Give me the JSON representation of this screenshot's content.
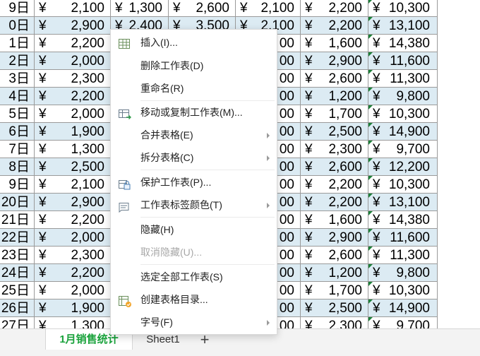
{
  "columns": {
    "currency_symbol": "¥"
  },
  "rows": [
    {
      "day": "9日",
      "a": "2,100",
      "b": "1,300",
      "c": "2,600",
      "d": "2,100",
      "e": "2,200",
      "total": "10,300"
    },
    {
      "day": "0日",
      "a": "2,900",
      "b": "2,400",
      "c": "3,500",
      "d": "2,100",
      "e": "2,200",
      "total": "13,100"
    },
    {
      "day": "1日",
      "a": "2,200",
      "b": "",
      "c": "",
      "d": "00",
      "e": "1,600",
      "total": "14,380"
    },
    {
      "day": "2日",
      "a": "2,000",
      "b": "",
      "c": "",
      "d": "00",
      "e": "2,900",
      "total": "11,600"
    },
    {
      "day": "3日",
      "a": "2,300",
      "b": "",
      "c": "",
      "d": "00",
      "e": "2,600",
      "total": "11,300"
    },
    {
      "day": "4日",
      "a": "2,200",
      "b": "",
      "c": "",
      "d": "00",
      "e": "1,200",
      "total": "9,800"
    },
    {
      "day": "5日",
      "a": "2,000",
      "b": "",
      "c": "",
      "d": "00",
      "e": "1,700",
      "total": "10,300"
    },
    {
      "day": "6日",
      "a": "1,900",
      "b": "",
      "c": "",
      "d": "00",
      "e": "2,500",
      "total": "14,900"
    },
    {
      "day": "7日",
      "a": "1,300",
      "b": "",
      "c": "",
      "d": "00",
      "e": "2,300",
      "total": "9,700"
    },
    {
      "day": "8日",
      "a": "2,500",
      "b": "",
      "c": "",
      "d": "00",
      "e": "2,600",
      "total": "12,200"
    },
    {
      "day": "9日",
      "a": "2,100",
      "b": "",
      "c": "",
      "d": "00",
      "e": "2,200",
      "total": "10,300"
    },
    {
      "day": "20日",
      "a": "2,900",
      "b": "",
      "c": "",
      "d": "00",
      "e": "2,200",
      "total": "13,100"
    },
    {
      "day": "21日",
      "a": "2,200",
      "b": "",
      "c": "",
      "d": "00",
      "e": "1,600",
      "total": "14,380"
    },
    {
      "day": "22日",
      "a": "2,000",
      "b": "",
      "c": "",
      "d": "00",
      "e": "2,900",
      "total": "11,600"
    },
    {
      "day": "23日",
      "a": "2,300",
      "b": "",
      "c": "",
      "d": "00",
      "e": "2,600",
      "total": "11,300"
    },
    {
      "day": "24日",
      "a": "2,200",
      "b": "",
      "c": "",
      "d": "00",
      "e": "1,200",
      "total": "9,800"
    },
    {
      "day": "25日",
      "a": "2,000",
      "b": "",
      "c": "",
      "d": "00",
      "e": "1,700",
      "total": "10,300"
    },
    {
      "day": "26日",
      "a": "1,900",
      "b": "",
      "c": "",
      "d": "00",
      "e": "2,500",
      "total": "14,900"
    },
    {
      "day": "27日",
      "a": "1,300",
      "b": "",
      "c": "",
      "d": "00",
      "e": "2,300",
      "total": "9,700"
    }
  ],
  "tabs": {
    "active": "1月销售统计",
    "sheet1": "Sheet1",
    "add": "+"
  },
  "context_menu": {
    "insert": "插入(I)...",
    "delete_sheet": "删除工作表(D)",
    "rename": "重命名(R)",
    "move_copy": "移动或复制工作表(M)...",
    "merge_tables": "合并表格(E)",
    "split_tables": "拆分表格(C)",
    "protect_sheet": "保护工作表(P)...",
    "tab_color": "工作表标签颜色(T)",
    "hide": "隐藏(H)",
    "unhide": "取消隐藏(U)...",
    "select_all": "选定全部工作表(S)",
    "create_toc": "创建表格目录...",
    "font_size": "字号(F)"
  },
  "colors": {
    "alt_row": "#dcebf3",
    "active_tab_text": "#1aa23c",
    "error_indicator": "#1a7f37"
  }
}
